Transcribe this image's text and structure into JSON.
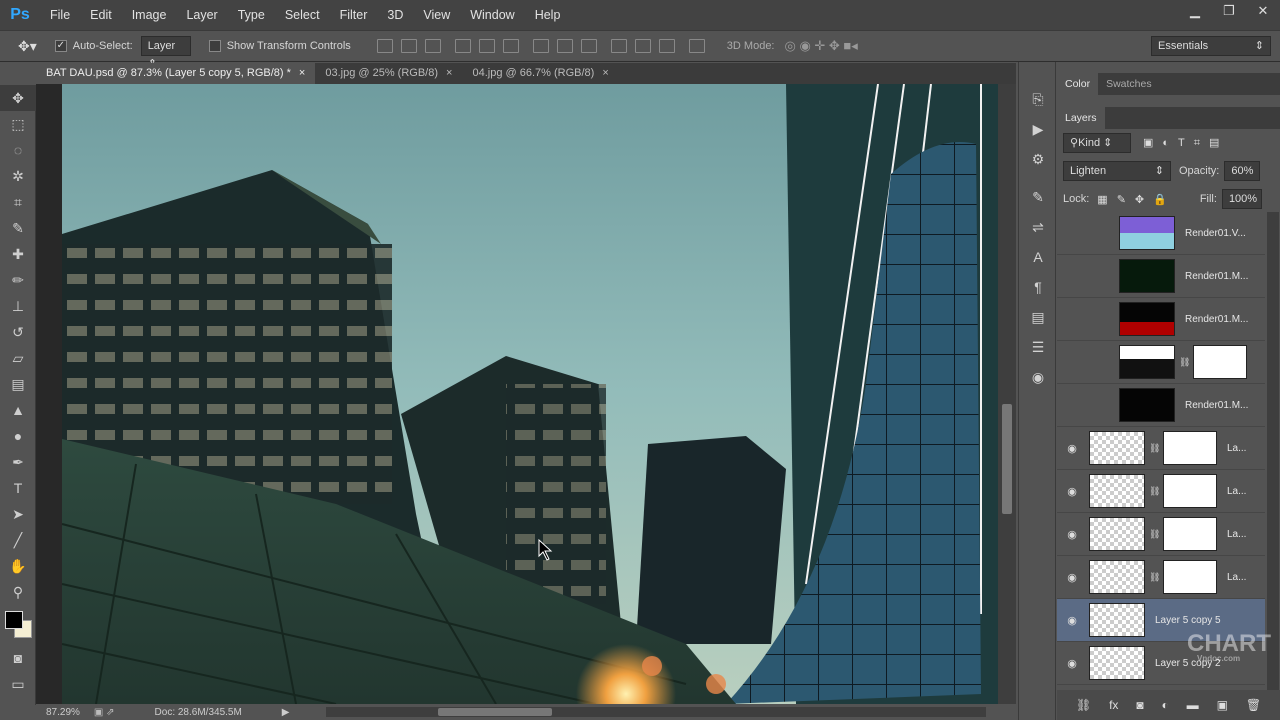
{
  "app": {
    "logo": "Ps"
  },
  "menu": [
    "File",
    "Edit",
    "Image",
    "Layer",
    "Type",
    "Select",
    "Filter",
    "3D",
    "View",
    "Window",
    "Help"
  ],
  "window_controls": {
    "minimize": "▁",
    "restore": "❐",
    "close": "✕"
  },
  "options": {
    "auto_select_label": "Auto-Select:",
    "auto_select_checked": "✓",
    "auto_select_target": "Layer",
    "transform_label": "Show Transform Controls",
    "mode_3d_label": "3D Mode:",
    "workspace": "Essentials"
  },
  "tabs": [
    {
      "title": "BAT DAU.psd @ 87.3% (Layer 5 copy 5, RGB/8) *",
      "close": "×"
    },
    {
      "title": "03.jpg @ 25% (RGB/8)",
      "close": "×"
    },
    {
      "title": "04.jpg @ 66.7% (RGB/8)",
      "close": "×"
    }
  ],
  "status": {
    "zoom": "87.29%",
    "doc": "Doc: 28.6M/345.5M"
  },
  "panels": {
    "color_tabs": [
      "Color",
      "Swatches"
    ],
    "layers_title": "Layers",
    "filter_kind": "Kind",
    "blend_mode": "Lighten",
    "opacity_label": "Opacity:",
    "opacity": "60%",
    "lock_label": "Lock:",
    "fill_label": "Fill:",
    "fill": "100%"
  },
  "layers": [
    {
      "name": "Render01.V...",
      "visible": false,
      "thumb": "color"
    },
    {
      "name": "Render01.M...",
      "visible": false,
      "thumb": "dark-green"
    },
    {
      "name": "Render01.M...",
      "visible": false,
      "thumb": "dark-red"
    },
    {
      "name": "",
      "visible": false,
      "thumb": "silhouette",
      "mask": true
    },
    {
      "name": "Render01.M...",
      "visible": false,
      "thumb": "dark"
    },
    {
      "name": "La...",
      "visible": true,
      "thumb": "checker",
      "mask": true
    },
    {
      "name": "La...",
      "visible": true,
      "thumb": "checker",
      "mask": true
    },
    {
      "name": "La...",
      "visible": true,
      "thumb": "checker",
      "mask": true
    },
    {
      "name": "La...",
      "visible": true,
      "thumb": "checker",
      "mask": true
    },
    {
      "name": "Layer 5 copy 5",
      "visible": true,
      "thumb": "checker",
      "selected": true
    },
    {
      "name": "Layer 5 copy 2",
      "visible": true,
      "thumb": "checker"
    }
  ],
  "watermark": {
    "brand": "CHART",
    "url": "Vndoc.com"
  },
  "colors": {
    "accent": "#31a8ff",
    "selected_layer": "#5b6b85",
    "sky": "#8fb8b8"
  }
}
